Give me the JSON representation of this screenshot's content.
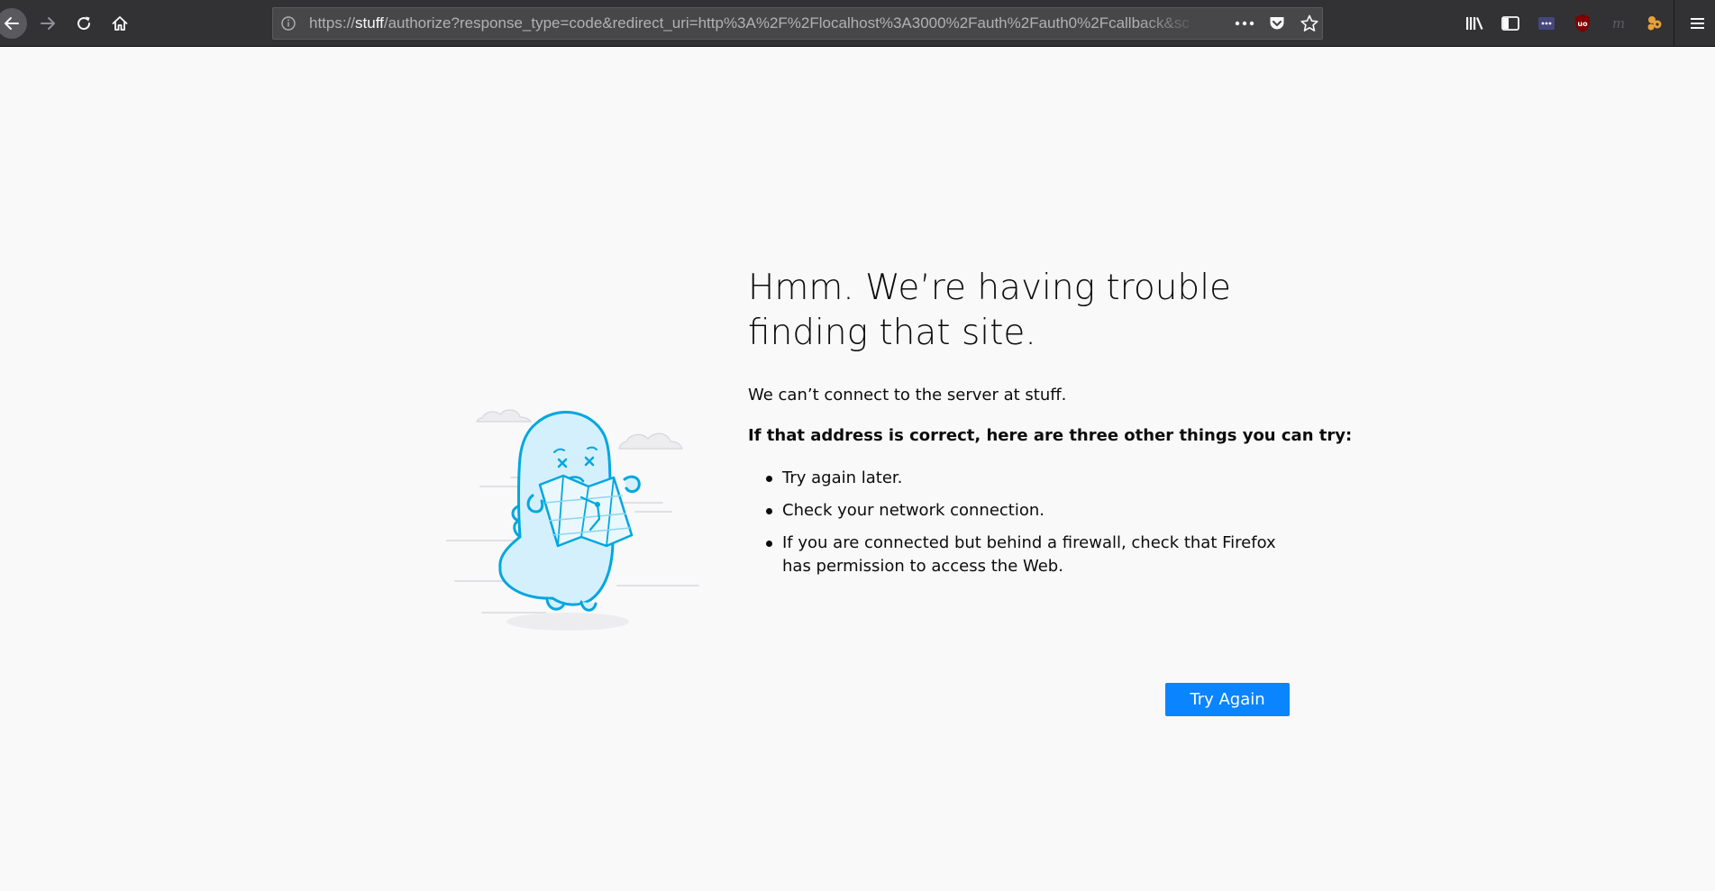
{
  "browser": {
    "url": {
      "prefix": "https://",
      "host": "stuff",
      "path": "/authorize?response_type=code&redirect_uri=http%3A%2F%2Flocalhost%3A3000%2Fauth%2Fauth0%2Fcallback&sc"
    },
    "icons": {
      "back": "back-arrow-icon",
      "forward": "forward-arrow-icon",
      "reload": "reload-icon",
      "home": "home-icon",
      "site_info": "info-icon",
      "page_actions": "more-dots-icon",
      "pocket": "pocket-icon",
      "bookmark": "star-icon",
      "library": "library-icon",
      "sidebar": "sidebar-icon",
      "menu": "hamburger-menu-icon"
    },
    "colors": {
      "toolbar": "#323234",
      "urlbar": "#474749",
      "accent": "#0a84ff"
    }
  },
  "error_page": {
    "title": "Hmm. We’re having trouble finding that site.",
    "short_description": "We can’t connect to the server at stuff.",
    "long_description_title": "If that address is correct, here are three other things you can try:",
    "suggestions": [
      "Try again later.",
      "Check your network connection.",
      "If you are connected but behind a firewall, check that Firefox has permission to access the Web."
    ],
    "try_again_label": "Try Again"
  }
}
